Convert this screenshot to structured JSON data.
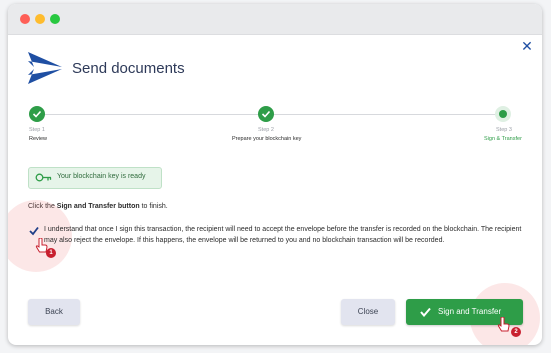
{
  "dialog": {
    "title": "Send documents"
  },
  "stepper": {
    "steps": [
      {
        "number": "Step 1",
        "label": "Review",
        "status": "done"
      },
      {
        "number": "Step 2",
        "label": "Prepare your blockchain key",
        "status": "done"
      },
      {
        "number": "Step 3",
        "label": "Sign & Transfer",
        "status": "current"
      }
    ]
  },
  "key_status": {
    "text": "Your blockchain key is ready"
  },
  "instruction": {
    "prefix": "Click the ",
    "emphasis": "Sign and Transfer button",
    "suffix": " to finish."
  },
  "consent": {
    "checked": true,
    "text": "I understand that once I sign this transaction, the recipient will need to accept the envelope before the transfer is recorded on the blockchain. The recipient may also reject the envelope. If this happens, the envelope will be returned to you and no blockchain transaction will be recorded."
  },
  "buttons": {
    "back": "Back",
    "close": "Close",
    "sign": "Sign and Transfer"
  },
  "annotations": {
    "marker_1": "1",
    "marker_2": "2"
  },
  "colors": {
    "accent_green": "#2e9d48",
    "brand_blue": "#1f4fa3",
    "marker_red": "#c8202f"
  }
}
